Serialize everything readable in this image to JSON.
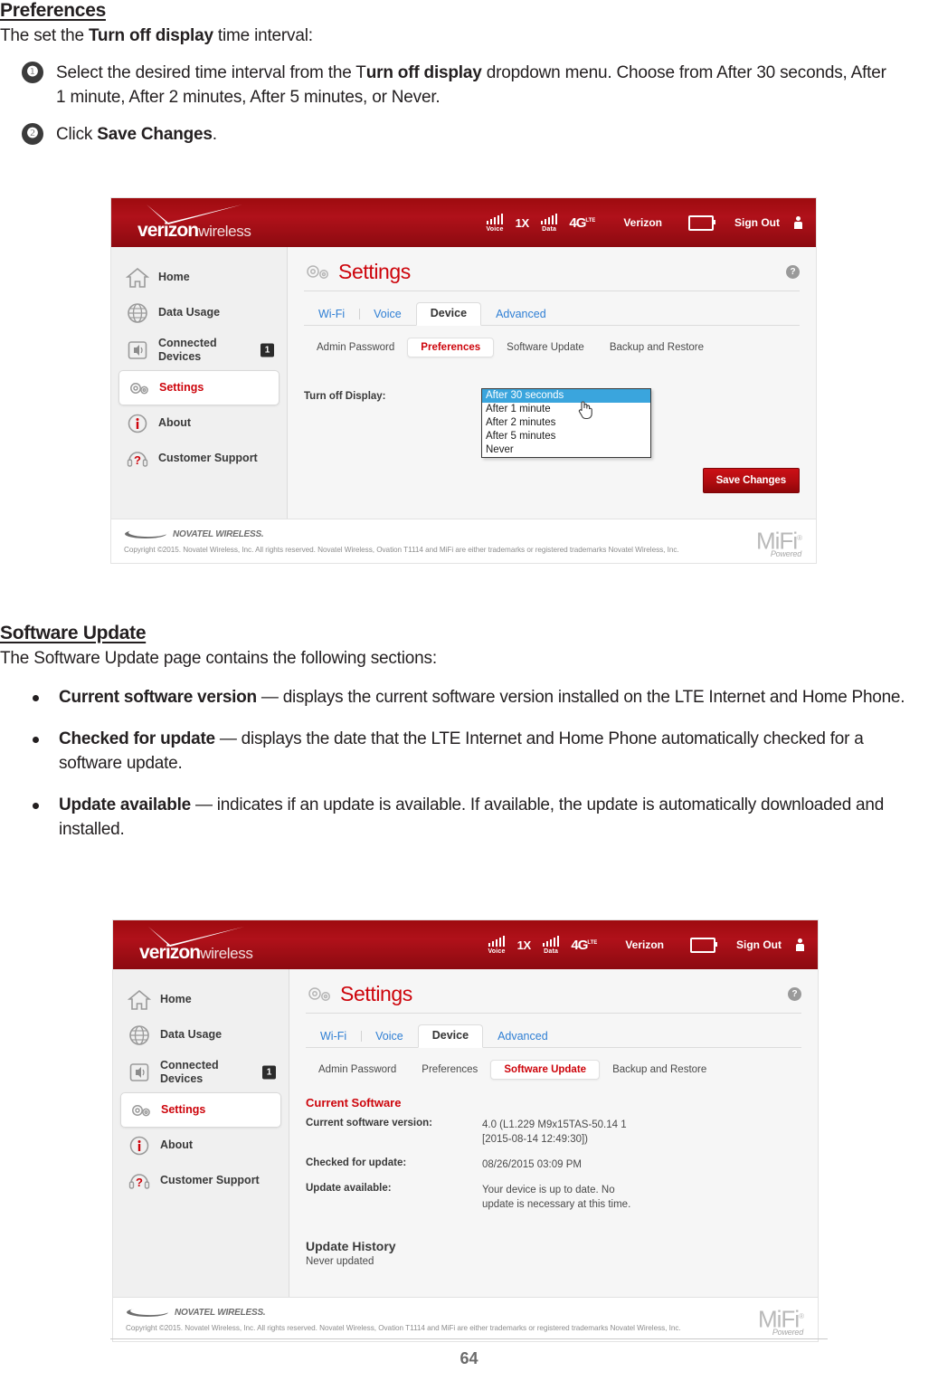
{
  "document": {
    "page_number": "64",
    "sections": [
      {
        "heading": "Preferences",
        "intro_prefix": "The set the ",
        "intro_bold": "Turn off display",
        "intro_suffix": " time interval:",
        "steps": [
          {
            "num": "❶",
            "part1": "Select the desired time interval from the T",
            "bold": "urn off display",
            "part2": " dropdown menu. Choose from After 30 seconds, After 1 minute, After 2 minutes, After 5 minutes, or Never."
          },
          {
            "num": "❷",
            "part1": "Click ",
            "bold": "Save Changes",
            "part2": "."
          }
        ]
      },
      {
        "heading": "Software Update",
        "intro": "The Software Update page contains the following sections:",
        "bullets": [
          {
            "term": "Current software version",
            "desc": " — displays the current software version installed on the LTE Internet and Home Phone."
          },
          {
            "term": "Checked for update",
            "desc": " — displays the date that the LTE Internet and Home Phone automatically checked for a software update."
          },
          {
            "term": "Update available",
            "desc": " — indicates if an update is available. If available, the update is automatically downloaded and installed."
          }
        ]
      }
    ]
  },
  "colors": {
    "verizon_red": "#cd040b",
    "header_red": "#b0111a",
    "link_blue": "#2f7fd4",
    "select_blue": "#3aa5dd"
  },
  "ui_header": {
    "logo_word": "verizon",
    "logo_z": "z",
    "logo_sub": "wireless",
    "voice_label": "Voice",
    "net_1x": "1X",
    "data_label": "Data",
    "net_4g": "4G",
    "net_4g_sup": "LTE",
    "carrier": "Verizon",
    "signout": "Sign Out"
  },
  "sidebar": {
    "items": [
      {
        "label": "Home",
        "icon": "home-icon",
        "badge": ""
      },
      {
        "label": "Data Usage",
        "icon": "globe-icon",
        "badge": ""
      },
      {
        "label": "Connected Devices",
        "icon": "connected-devices-icon",
        "badge": "1"
      },
      {
        "label": "Settings",
        "icon": "gear-icon",
        "badge": ""
      },
      {
        "label": "About",
        "icon": "info-icon",
        "badge": ""
      },
      {
        "label": "Customer Support",
        "icon": "headset-question-icon",
        "badge": ""
      }
    ]
  },
  "settings": {
    "title": "Settings",
    "help": "?",
    "tabs": [
      {
        "label": "Wi-Fi"
      },
      {
        "label": "Voice"
      },
      {
        "label": "Device"
      },
      {
        "label": "Advanced"
      }
    ],
    "subtabs": [
      {
        "label": "Admin Password"
      },
      {
        "label": "Preferences"
      },
      {
        "label": "Software Update"
      },
      {
        "label": "Backup and Restore"
      }
    ]
  },
  "preferences_panel": {
    "field_label": "Turn off Display:",
    "options": [
      "After 30 seconds",
      "After 1 minute",
      "After 2 minutes",
      "After 5 minutes",
      "Never"
    ],
    "selected_option": "After 30 seconds",
    "save_button": "Save Changes"
  },
  "software_panel": {
    "section_title": "Current Software",
    "rows": [
      {
        "key": "Current software version:",
        "value": "4.0 (L1.229 M9x15TAS-50.14 1\n[2015-08-14 12:49:30])"
      },
      {
        "key": "Checked for update:",
        "value": "08/26/2015 03:09 PM"
      },
      {
        "key": "Update available:",
        "value": "Your device is up to date. No\nupdate is necessary at this time."
      }
    ],
    "history_title": "Update History",
    "history_value": "Never updated"
  },
  "footer": {
    "novatel": "NOVATEL WIRELESS.",
    "copyright": "Copyright ©2015. Novatel Wireless, Inc. All rights reserved. Novatel Wireless, Ovation T1114 and MiFi are either trademarks or registered trademarks Novatel Wireless, Inc.",
    "mifi": "MiFi",
    "mifi_sup": "®",
    "mifi_sub": "Powered"
  }
}
